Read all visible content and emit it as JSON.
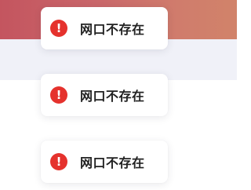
{
  "colors": {
    "banner_start": "#c4555f",
    "banner_end": "#d1836a",
    "band": "#f0f1f8",
    "error_icon": "#e5322d",
    "toast_bg": "#ffffff",
    "text": "#222222"
  },
  "toasts": [
    {
      "icon": "error-icon",
      "glyph": "!",
      "message": "网口不存在"
    },
    {
      "icon": "error-icon",
      "glyph": "!",
      "message": "网口不存在"
    },
    {
      "icon": "error-icon",
      "glyph": "!",
      "message": "网口不存在"
    }
  ]
}
